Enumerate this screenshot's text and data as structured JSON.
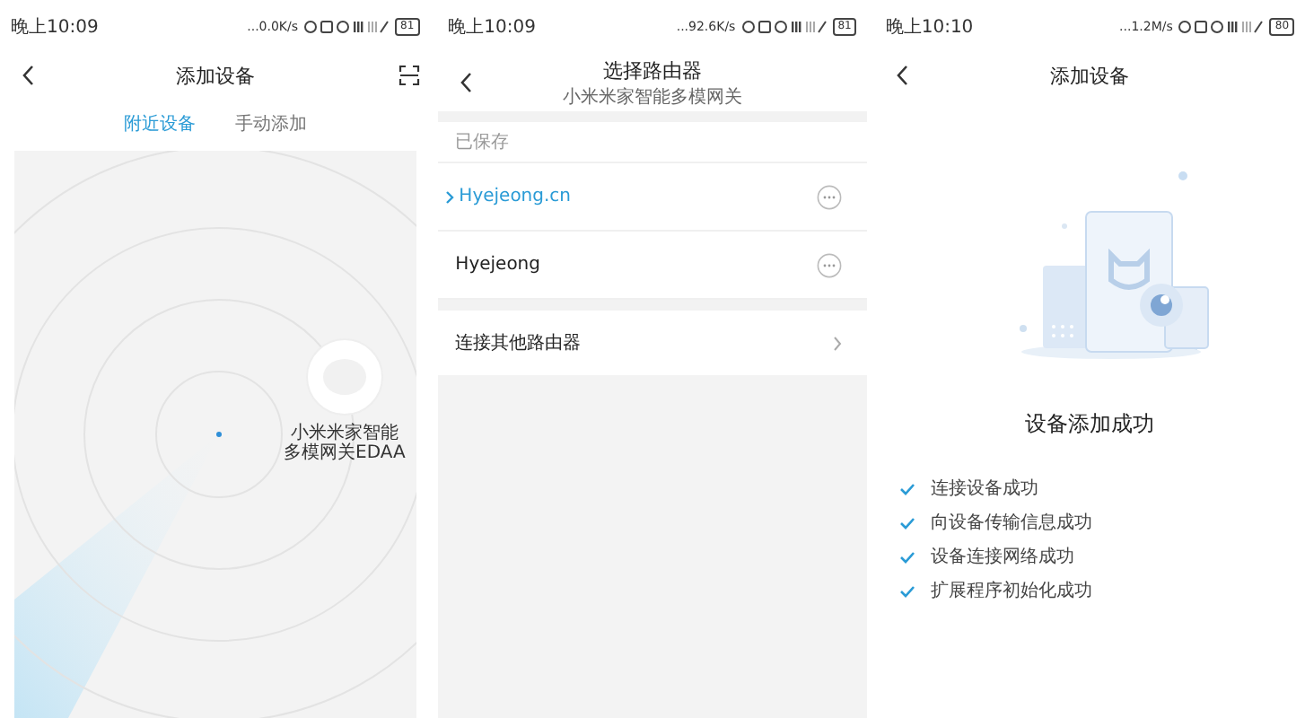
{
  "scan_screen": {
    "status_bar": {
      "time": "晚上10:09",
      "speed": "...0.0K/s",
      "battery": "81"
    },
    "title": "添加设备",
    "tabs": [
      {
        "label": "附近设备",
        "selected": true
      },
      {
        "label": "手动添加",
        "selected": false
      }
    ],
    "device_label_lines": [
      "小米米家智能",
      "多模网关EDAA"
    ]
  },
  "router_screen": {
    "status_bar": {
      "time": "晚上10:09",
      "speed": "...92.6K/s",
      "battery": "81"
    },
    "title": "选择路由器",
    "subtitle": "小米米家智能多模网关",
    "section_label": "已保存",
    "routers": [
      {
        "name": "Hyejeong.cn",
        "selected": true
      },
      {
        "name": "Hyejeong",
        "selected": false
      }
    ],
    "other_router": "连接其他路由器"
  },
  "success_screen": {
    "status_bar": {
      "time": "晚上10:10",
      "speed": "...1.2M/s",
      "battery": "80"
    },
    "title": "添加设备",
    "heading": "设备添加成功",
    "steps": [
      {
        "label": "连接设备成功",
        "checked": true
      },
      {
        "label": "向设备传输信息成功",
        "checked": true
      },
      {
        "label": "设备连接网络成功",
        "checked": true
      },
      {
        "label": "扩展程序初始化成功",
        "checked": true
      }
    ]
  }
}
